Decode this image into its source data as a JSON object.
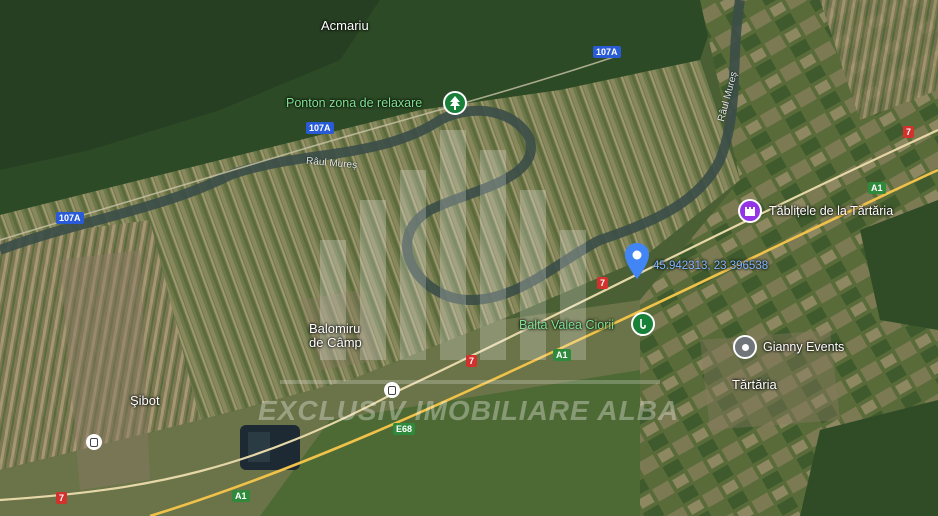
{
  "map": {
    "type": "satellite",
    "places": {
      "acmariu": "Acmariu",
      "balomiru": "Balomiru",
      "balomiru2": "de Câmp",
      "sibot": "Şibot",
      "tartaria": "Tărtăria"
    },
    "pois": {
      "ponton": "Ponton zona de relaxare",
      "tablitele": "Tăblițele de la Tărtăria",
      "balta": "Balta Valea Ciorii",
      "gianny": "Gianny Events"
    },
    "coordinates": "45.942313, 23.396538",
    "rivers": {
      "mures_left": "Râul Mureș",
      "mures_right": "Râul Mureș"
    },
    "roads": {
      "r107a_1": "107A",
      "r107a_2": "107A",
      "r107a_3": "107A",
      "r7_1": "7",
      "r7_2": "7",
      "r7_3": "7",
      "r7_4": "7",
      "a1_1": "A1",
      "a1_2": "A1",
      "a1_3": "A1",
      "e68": "E68"
    },
    "watermark": "EXCLUSIV IMOBILIARE ALBA",
    "colors": {
      "marker_blue": "#4285f4",
      "poi_green": "#188038",
      "poi_purple": "#9334e6",
      "poi_gray": "#70757a"
    }
  }
}
